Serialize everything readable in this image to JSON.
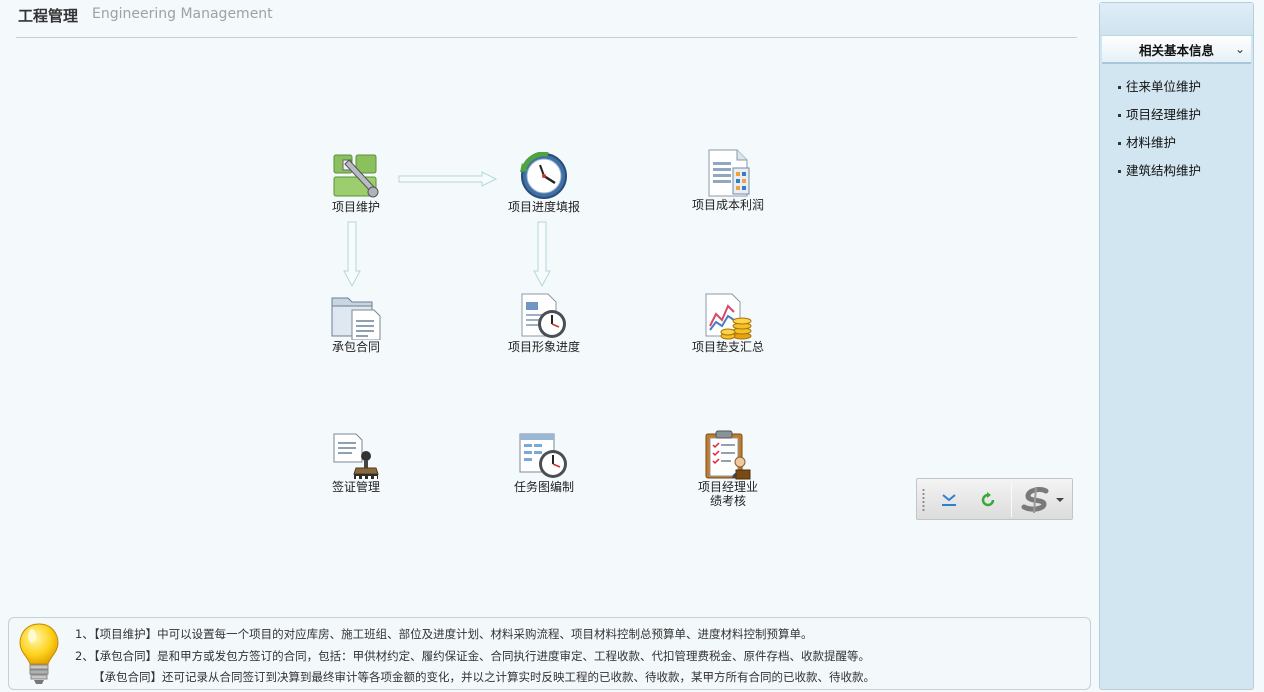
{
  "header": {
    "title_cn": "工程管理",
    "title_en": "Engineering Management"
  },
  "modules": {
    "project_maintenance": {
      "label": "项目维护",
      "icon": "project-maintenance-icon"
    },
    "progress_report": {
      "label": "项目进度填报",
      "icon": "clock-icon"
    },
    "cost_profit": {
      "label": "项目成本利润",
      "icon": "report-chart-icon"
    },
    "contract": {
      "label": "承包合同",
      "icon": "folder-document-icon"
    },
    "image_progress": {
      "label": "项目形象进度",
      "icon": "document-clock-icon"
    },
    "advance_summary": {
      "label": "项目垫支汇总",
      "icon": "chart-coins-icon"
    },
    "visa_management": {
      "label": "签证管理",
      "icon": "stamp-icon"
    },
    "task_chart": {
      "label": "任务图编制",
      "icon": "schedule-clock-icon"
    },
    "pm_performance": {
      "label_line1": "项目经理业",
      "label_line2": "绩考核",
      "icon": "clipboard-person-icon"
    }
  },
  "toolbar": {
    "items": [
      "download-icon",
      "refresh-icon",
      "dollar-dropdown-icon"
    ]
  },
  "tips": {
    "line1": "1、【项目维护】中可以设置每一个项目的对应库房、施工班组、部位及进度计划、材料采购流程、项目材料控制总预算单、进度材料控制预算单。",
    "line2": "2、【承包合同】是和甲方或发包方签订的合同，包括：甲供材约定、履约保证金、合同执行进度审定、工程收款、代扣管理费税金、原件存档、收款提醒等。",
    "line3": "【承包合同】还可记录从合同签订到决算到最终审计等各项金额的变化，并以之计算实时反映工程的已收款、待收款，某甲方所有合同的已收款、待收款。"
  },
  "sidebar": {
    "panel_title": "相关基本信息",
    "links": [
      "往来单位维护",
      "项目经理维护",
      "材料维护",
      "建筑结构维护"
    ]
  }
}
